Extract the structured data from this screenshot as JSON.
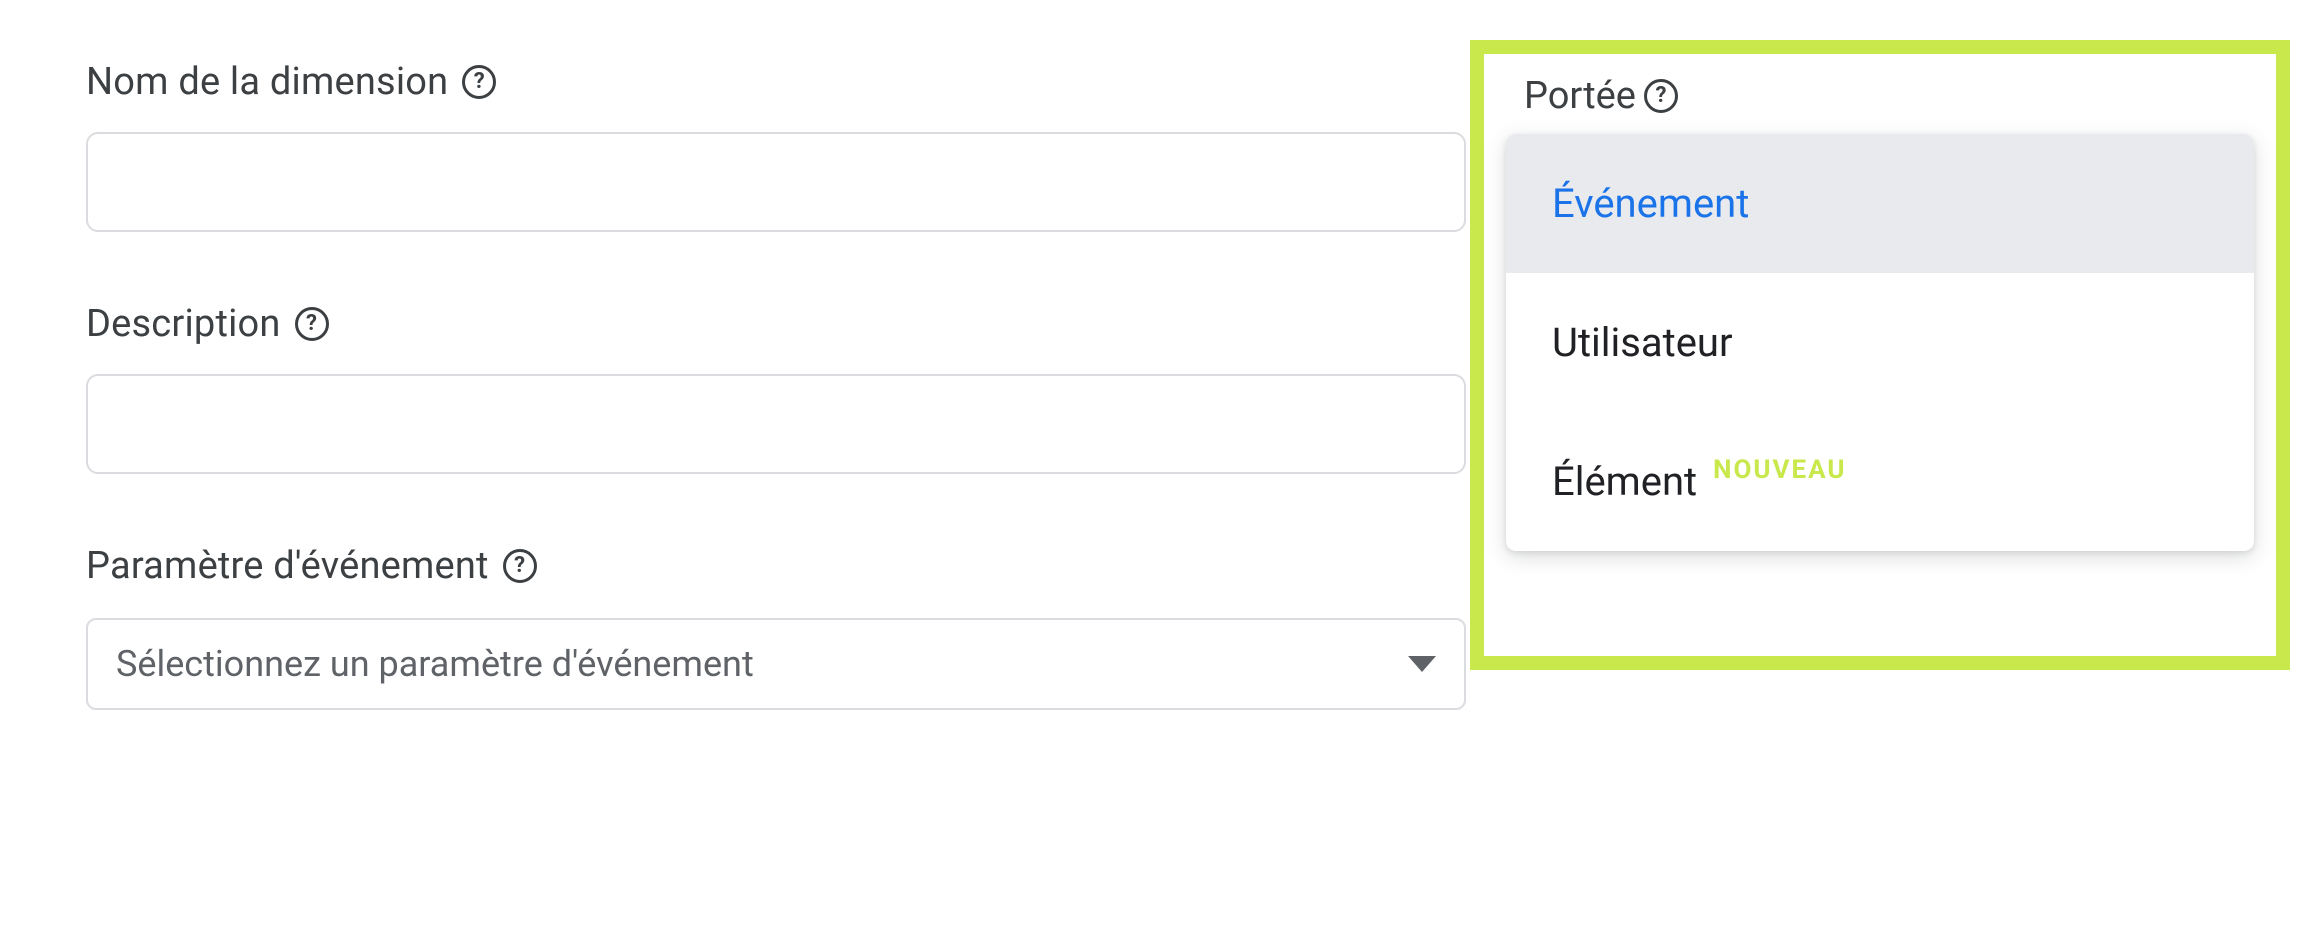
{
  "fields": {
    "dimension_name": {
      "label": "Nom de la dimension",
      "value": ""
    },
    "description": {
      "label": "Description",
      "value": ""
    },
    "event_parameter": {
      "label": "Paramètre d'événement",
      "placeholder": "Sélectionnez un paramètre d'événement"
    }
  },
  "scope": {
    "label": "Portée",
    "options": [
      {
        "label": "Événement",
        "selected": true
      },
      {
        "label": "Utilisateur",
        "selected": false
      },
      {
        "label": "Élément",
        "selected": false,
        "badge": "NOUVEAU"
      }
    ]
  },
  "help_glyph": "?"
}
